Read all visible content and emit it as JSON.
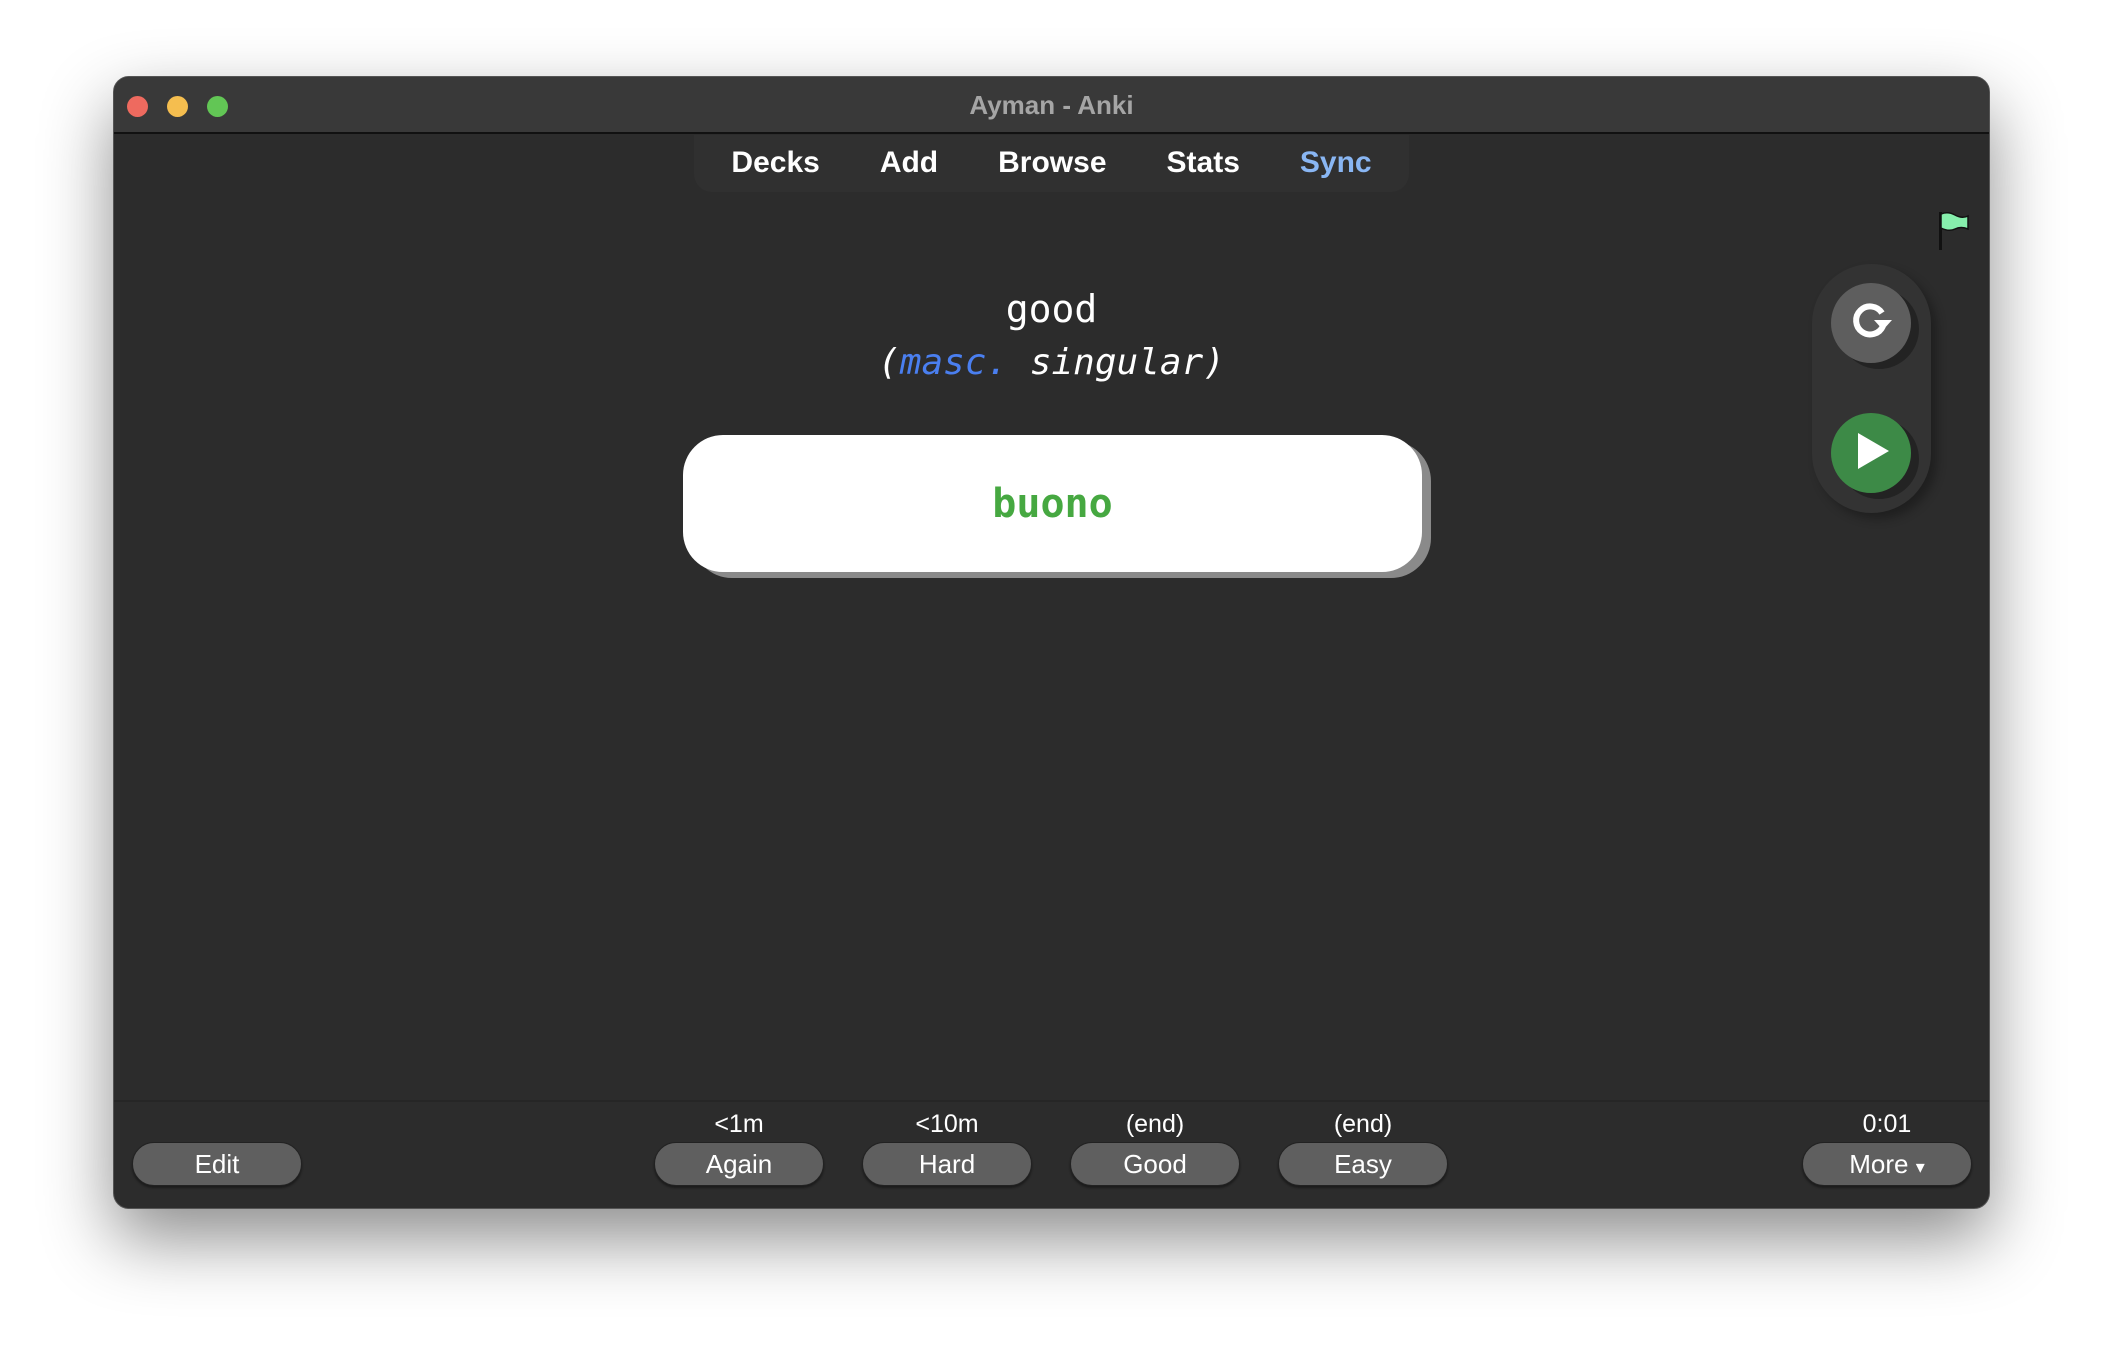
{
  "window": {
    "title": "Ayman - Anki"
  },
  "nav": {
    "items": [
      "Decks",
      "Add",
      "Browse",
      "Stats",
      "Sync"
    ]
  },
  "card": {
    "front": "good",
    "hint_open": "(",
    "hint_gender": "masc.",
    "hint_rest": " singular)",
    "answer": "buono"
  },
  "side": {
    "flag_color": "#86efac",
    "replay_icon": "replay-icon",
    "play_icon": "play-icon"
  },
  "bottom": {
    "edit": "Edit",
    "answers": [
      {
        "interval": "<1m",
        "label": "Again"
      },
      {
        "interval": "<10m",
        "label": "Hard"
      },
      {
        "interval": "(end)",
        "label": "Good"
      },
      {
        "interval": "(end)",
        "label": "Easy"
      }
    ],
    "timer": "0:01",
    "more": "More",
    "more_caret": "▾"
  }
}
